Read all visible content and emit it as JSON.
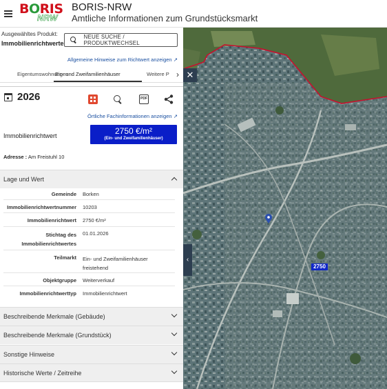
{
  "header": {
    "logo_text": "BORIS",
    "logo_sub": "NRW",
    "title": "BORIS-NRW",
    "subtitle": "Amtliche Informationen zum Grundstücksmarkt"
  },
  "product": {
    "label": "Ausgewähltes Produkt:",
    "value": "Immobilienrichtwerte",
    "search_button": "NEUE SUCHE / PRODUKTWECHSEL",
    "hint_link": "Allgemeine Hinweise zum Richtwert anzeigen"
  },
  "tabs": [
    {
      "label": "Eigentumswohnungen"
    },
    {
      "label": "Ein- und Zweifamilienhäuser"
    },
    {
      "label": "Weitere P"
    }
  ],
  "toolbar": {
    "year": "2026",
    "icons": [
      "grid-icon",
      "search-icon",
      "pdf-icon",
      "share-icon"
    ]
  },
  "local_link": "Örtliche Fachinformationen anzeigen",
  "valuation": {
    "label": "Immobilienrichtwert",
    "value": "2750 €/m²",
    "value_sub": "(Ein- und Zweifamilienhäuser)",
    "address_label": "Adresse :",
    "address": "Am Freistuhl 10"
  },
  "section_lage": {
    "title": "Lage und Wert",
    "rows": [
      {
        "k": "Gemeinde",
        "v": "Borken"
      },
      {
        "k": "Immobilienrichtwertnummer",
        "v": "10203"
      },
      {
        "k": "Immobilienrichtwert",
        "v": "2750 €/m²"
      },
      {
        "k": "Stichtag des Immobilienrichtwertes",
        "v": "01.01.2026"
      },
      {
        "k": "Teilmarkt",
        "v": "Ein- und Zweifamilienhäuser freistehend"
      },
      {
        "k": "Objektgruppe",
        "v": "Weiterverkauf"
      },
      {
        "k": "Immobilienrichtwerttyp",
        "v": "Immobilienrichtwert"
      }
    ]
  },
  "sections": [
    {
      "title": "Beschreibende Merkmale (Gebäude)"
    },
    {
      "title": "Beschreibende Merkmale (Grundstück)"
    },
    {
      "title": "Sonstige Hinweise"
    },
    {
      "title": "Historische Werte / Zeitreihe"
    }
  ],
  "map": {
    "value_label": "2750",
    "boundary_color": "#c8102e",
    "marker_color": "#2a4fb0"
  }
}
